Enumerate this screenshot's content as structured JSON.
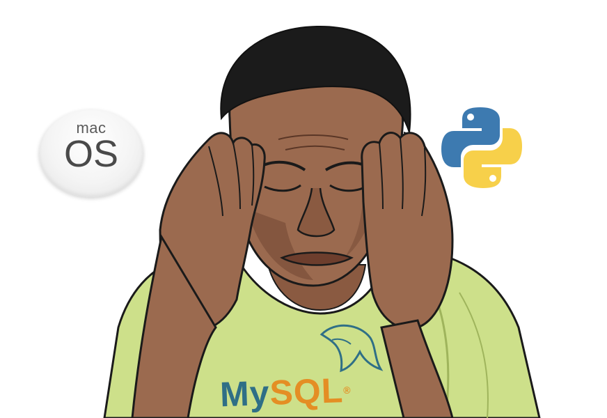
{
  "logos": {
    "macos": {
      "line1": "mac",
      "line2": "OS"
    },
    "python": {
      "icon": "python-logo-icon",
      "colors": {
        "blue": "#3d7ab0",
        "yellow": "#f7d04a"
      }
    },
    "mysql": {
      "part1": "My",
      "part2": "SQL",
      "mark": "®",
      "icon": "dolphin-icon",
      "colors": {
        "blue": "#2f6f86",
        "orange": "#e48e24"
      }
    }
  },
  "illustration": {
    "subject": "stressed-man-holding-head",
    "colors": {
      "skin": "#9b6a4f",
      "skin_shadow": "#7a4f39",
      "hair": "#1b1b1b",
      "shirt": "#cde08a",
      "shirt_shadow": "#b8cc72",
      "outline": "#1a1a1a"
    }
  }
}
